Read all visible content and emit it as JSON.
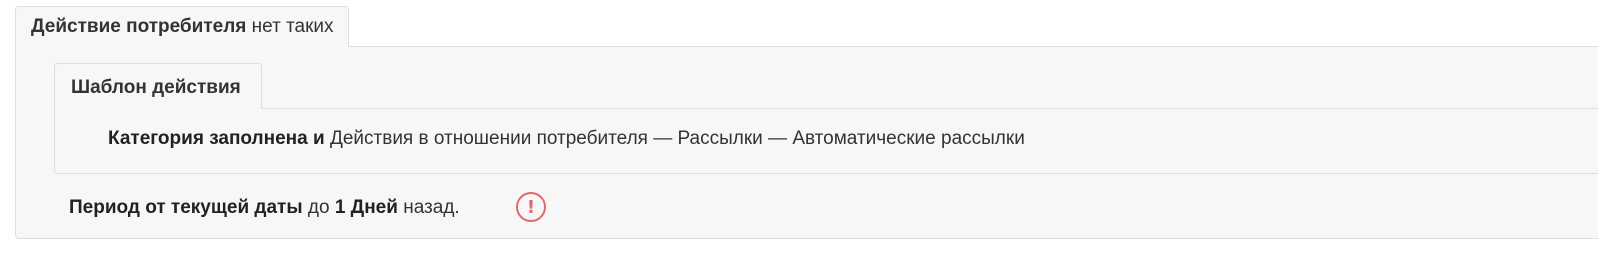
{
  "consumer_action": {
    "label": "Действие потребителя",
    "value": "нет таких"
  },
  "action_template": {
    "tab_label": "Шаблон действия",
    "category_filled_label": "Категория заполнена и",
    "category_path": "Действия в отношении потребителя — Рассылки — Автоматические рассылки"
  },
  "period": {
    "label": "Период от текущей даты",
    "to_word": "до",
    "amount": "1 Дней",
    "suffix": "назад.",
    "alert_icon": "exclamation-circle-icon",
    "alert_color": "#e06a6a"
  }
}
